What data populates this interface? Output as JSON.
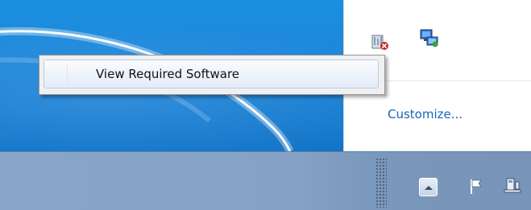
{
  "context_menu": {
    "items": [
      {
        "label": "View Required Software"
      }
    ]
  },
  "tray_flyout": {
    "icons": [
      "network-monitor-icon",
      "network-computer-icon"
    ],
    "customize_link": "Customize..."
  },
  "taskbar": {
    "tray_icons": [
      "show-hidden-icons-button",
      "action-center-flag-icon",
      "network-icon"
    ]
  },
  "colors": {
    "desktop": "#1f86d8",
    "taskbar": "#86a3c5",
    "link": "#1a64b8",
    "menu_highlight_border": "#b9cde6"
  }
}
